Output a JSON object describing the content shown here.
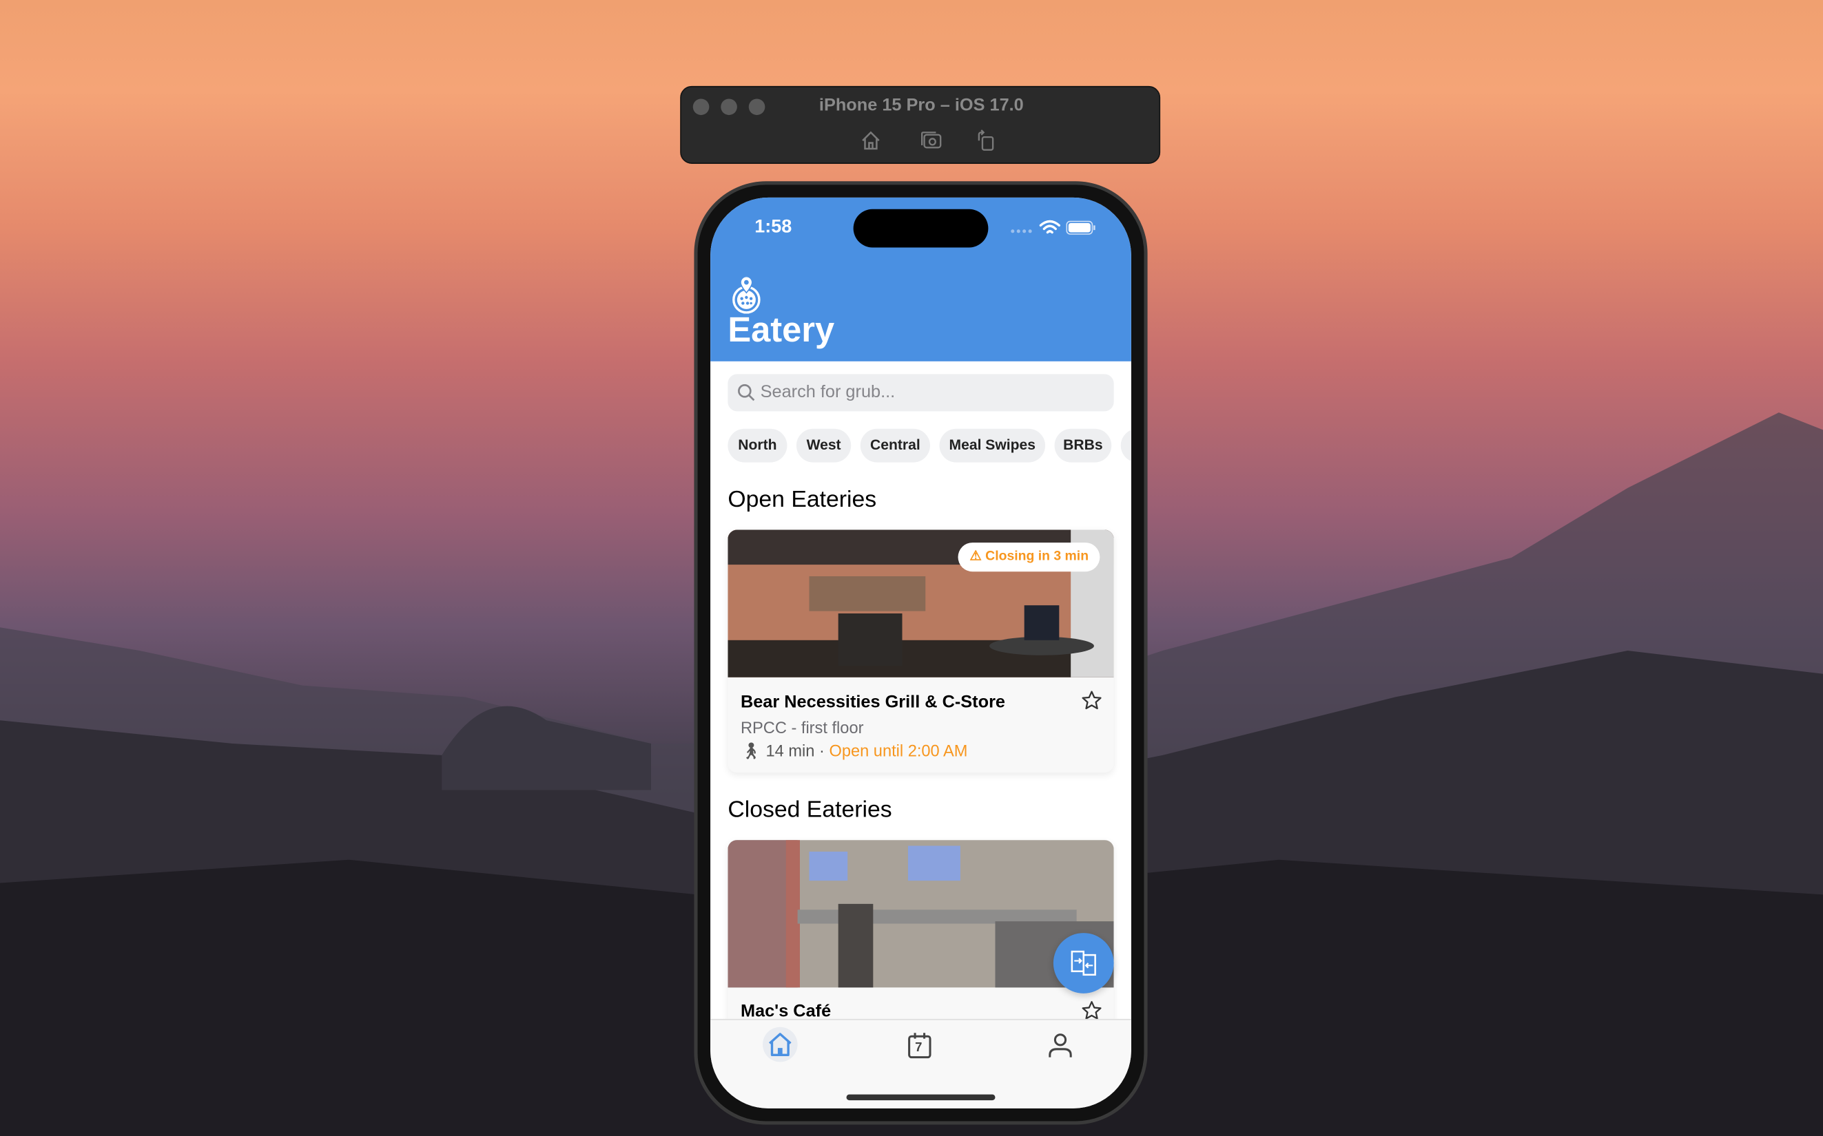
{
  "simulator": {
    "title": "iPhone 15 Pro – iOS 17.0",
    "icons": [
      "home-icon",
      "screenshot-icon",
      "rotate-icon"
    ]
  },
  "status": {
    "time": "1:58"
  },
  "app": {
    "title": "Eatery",
    "accent": "#4a90e2",
    "warning_color": "#f7961e"
  },
  "search": {
    "placeholder": "Search for grub..."
  },
  "filters": [
    "North",
    "West",
    "Central",
    "Meal Swipes",
    "BRBs"
  ],
  "open": {
    "heading": "Open Eateries",
    "items": [
      {
        "name": "Bear Necessities Grill & C-Store",
        "location": "RPCC - first floor",
        "walk": "14 min",
        "separator": " · ",
        "status": "Open until 2:00 AM",
        "badge": "Closing in 3 min"
      }
    ]
  },
  "closed": {
    "heading": "Closed Eateries",
    "items": [
      {
        "name": "Mac's Café"
      }
    ]
  },
  "tabs": [
    {
      "icon": "home-icon",
      "active": true
    },
    {
      "icon": "calendar-icon",
      "label": "7"
    },
    {
      "icon": "profile-icon"
    }
  ]
}
